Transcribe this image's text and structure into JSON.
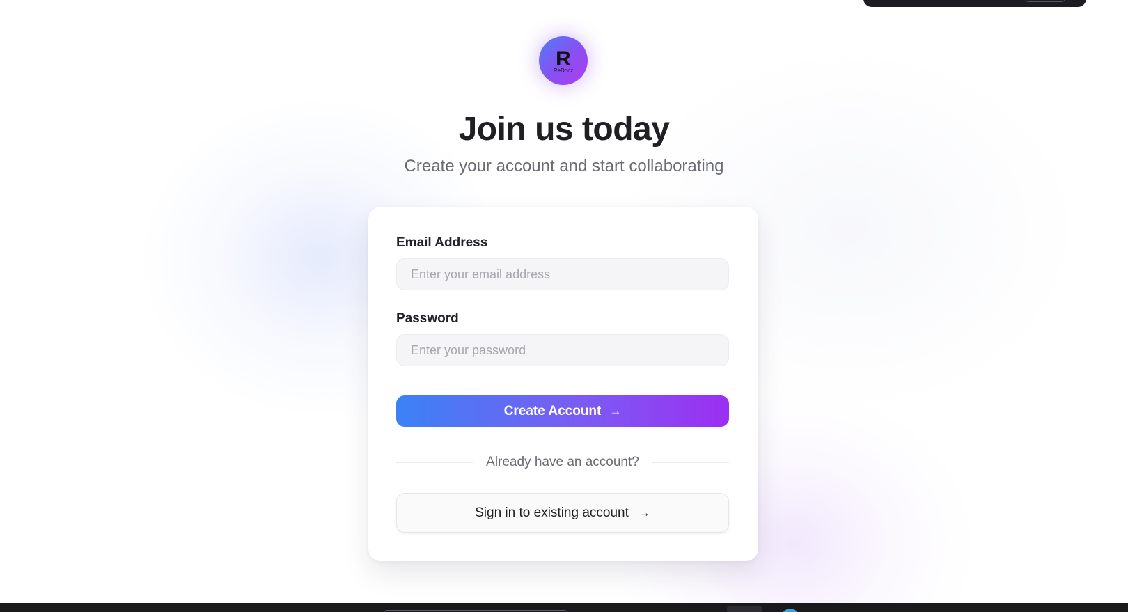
{
  "brand": {
    "logo_letter": "R",
    "logo_text": "ReDocz",
    "logo_gradient": [
      "#4f7cf6",
      "#b13cf0"
    ]
  },
  "header": {
    "title": "Join us today",
    "subtitle": "Create your account and start collaborating"
  },
  "form": {
    "email": {
      "label": "Email Address",
      "placeholder": "Enter your email address",
      "value": ""
    },
    "password": {
      "label": "Password",
      "placeholder": "Enter your password",
      "value": ""
    },
    "submit_label": "Create Account",
    "submit_icon": "arrow-right-icon",
    "divider_text": "Already have an account?",
    "signin_label": "Sign in to existing account",
    "signin_icon": "arrow-right-icon"
  },
  "colors": {
    "primary_gradient_start": "#3b82f6",
    "primary_gradient_end": "#9b2ff2",
    "title": "#1f1f24",
    "muted": "#6b6b74"
  }
}
